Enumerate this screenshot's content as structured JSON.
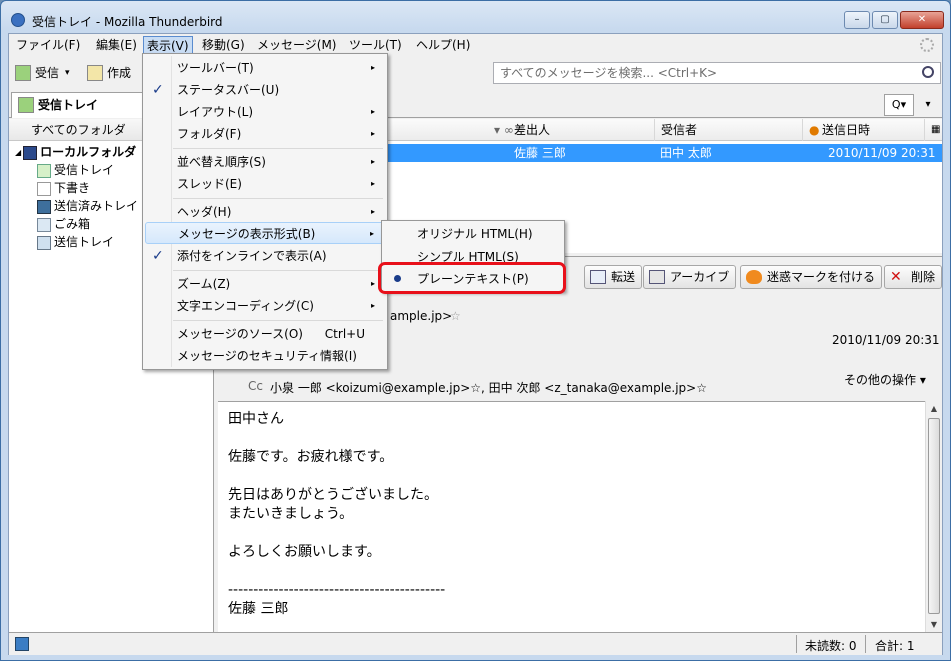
{
  "window": {
    "title": "受信トレイ - Mozilla Thunderbird",
    "btn_min": "–",
    "btn_max": "▢",
    "btn_close": "✕"
  },
  "menubar": [
    {
      "label": "ファイル(F)"
    },
    {
      "label": "編集(E)"
    },
    {
      "label": "表示(V)"
    },
    {
      "label": "移動(G)"
    },
    {
      "label": "メッセージ(M)"
    },
    {
      "label": "ツール(T)"
    },
    {
      "label": "ヘルプ(H)"
    }
  ],
  "toolbar": {
    "get": "受信",
    "get_dd": "▾",
    "write": "作成",
    "search_placeholder": "すべてのメッセージを検索... <Ctrl+K>"
  },
  "tab": {
    "label": "受信トレイ",
    "qf": "Q▾",
    "qf2": "▾"
  },
  "folders": {
    "header": "すべてのフォルダ",
    "items": [
      {
        "label": "ローカルフォルダ",
        "twisty": "◢"
      },
      {
        "label": "受信トレイ"
      },
      {
        "label": "下書き"
      },
      {
        "label": "送信済みトレイ"
      },
      {
        "label": "ごみ箱"
      },
      {
        "label": "送信トレイ"
      }
    ]
  },
  "thread": {
    "columns": {
      "from": "差出人",
      "to": "受信者",
      "date": "送信日時"
    },
    "rows": [
      {
        "from": "佐藤 三郎",
        "to": "田中 太郎",
        "date": "2010/11/09 20:31"
      }
    ]
  },
  "header": {
    "forward": "転送",
    "archive": "アーカイブ",
    "junk": "迷惑マークを付ける",
    "delete": "削除",
    "from_partial": "ample.jp>",
    "date": "2010/11/09 20:31",
    "other_actions": "その他の操作 ▾",
    "cc_label": "Cc",
    "cc_value": "小泉 一郎 <koizumi@example.jp>☆, 田中 次郎 <z_tanaka@example.jp>☆"
  },
  "body": "田中さん\n\n佐藤です。お疲れ様です。\n\n先日はありがとうございました。\nまたいきましょう。\n\nよろしくお願いします。\n\n-------------------------------------------\n佐藤 三郎",
  "status": {
    "unread": "未読数: 0",
    "total": "合計: 1"
  },
  "view_menu": {
    "items": [
      {
        "label": "ツールバー(T)",
        "sub": "▸"
      },
      {
        "label": "ステータスバー(U)",
        "check": "✓"
      },
      {
        "label": "レイアウト(L)",
        "sub": "▸"
      },
      {
        "label": "フォルダ(F)",
        "sub": "▸"
      },
      {
        "label": "並べ替え順序(S)",
        "sub": "▸"
      },
      {
        "label": "スレッド(E)",
        "sub": "▸"
      },
      {
        "label": "ヘッダ(H)",
        "sub": "▸"
      },
      {
        "label": "メッセージの表示形式(B)",
        "sub": "▸"
      },
      {
        "label": "添付をインラインで表示(A)",
        "check": "✓"
      },
      {
        "label": "ズーム(Z)",
        "sub": "▸"
      },
      {
        "label": "文字エンコーディング(C)",
        "sub": "▸"
      },
      {
        "label": "メッセージのソース(O)",
        "shortcut": "Ctrl+U"
      },
      {
        "label": "メッセージのセキュリティ情報(I)"
      }
    ]
  },
  "format_submenu": {
    "items": [
      {
        "label": "オリジナル HTML(H)"
      },
      {
        "label": "シンプル HTML(S)"
      },
      {
        "label": "プレーンテキスト(P)"
      }
    ]
  },
  "colors": {
    "selection": "#3399ff",
    "highlight_box": "#e8101a"
  }
}
